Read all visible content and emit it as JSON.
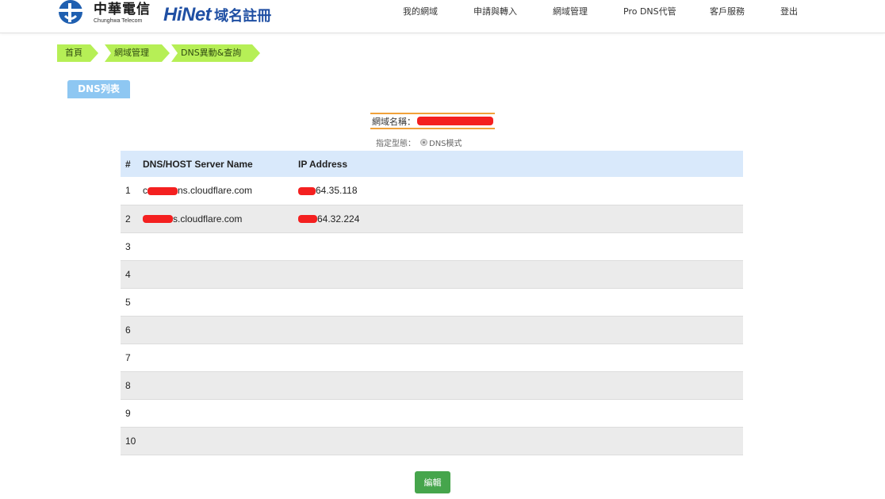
{
  "header": {
    "brand_zh": "中華電信",
    "brand_en": "Chunghwa Telecom",
    "hinet_word": "HiNet",
    "hinet_sub": "域名註冊",
    "nav": [
      "我的網域",
      "申請與轉入",
      "網域管理",
      "Pro DNS代管",
      "客戶服務",
      "登出"
    ]
  },
  "breadcrumb": [
    "首頁",
    "網域管理",
    "DNS異動&查詢"
  ],
  "section_title": "DNS列表",
  "domain": {
    "label": "網域名稱：",
    "mode_label": "指定型態：",
    "mode_value": "DNS模式"
  },
  "table": {
    "headers": [
      "#",
      "DNS/HOST Server Name",
      "IP Address"
    ],
    "rows": [
      {
        "num": "1",
        "host_prefix": "c",
        "host_suffix": "ns.cloudflare.com",
        "ip_suffix": "64.35.118"
      },
      {
        "num": "2",
        "host_prefix": "",
        "host_suffix": "s.cloudflare.com",
        "ip_suffix": "64.32.224"
      },
      {
        "num": "3",
        "host_prefix": "",
        "host_suffix": "",
        "ip_suffix": ""
      },
      {
        "num": "4",
        "host_prefix": "",
        "host_suffix": "",
        "ip_suffix": ""
      },
      {
        "num": "5",
        "host_prefix": "",
        "host_suffix": "",
        "ip_suffix": ""
      },
      {
        "num": "6",
        "host_prefix": "",
        "host_suffix": "",
        "ip_suffix": ""
      },
      {
        "num": "7",
        "host_prefix": "",
        "host_suffix": "",
        "ip_suffix": ""
      },
      {
        "num": "8",
        "host_prefix": "",
        "host_suffix": "",
        "ip_suffix": ""
      },
      {
        "num": "9",
        "host_prefix": "",
        "host_suffix": "",
        "ip_suffix": ""
      },
      {
        "num": "10",
        "host_prefix": "",
        "host_suffix": "",
        "ip_suffix": ""
      }
    ]
  },
  "edit_button": "編輯",
  "colors": {
    "breadcrumb_bg": "#b6ef56",
    "section_tag_bg": "#8ec7f2",
    "table_header_bg": "#d9e9fb",
    "edit_button_bg": "#46a54c",
    "redaction": "#f42020"
  }
}
